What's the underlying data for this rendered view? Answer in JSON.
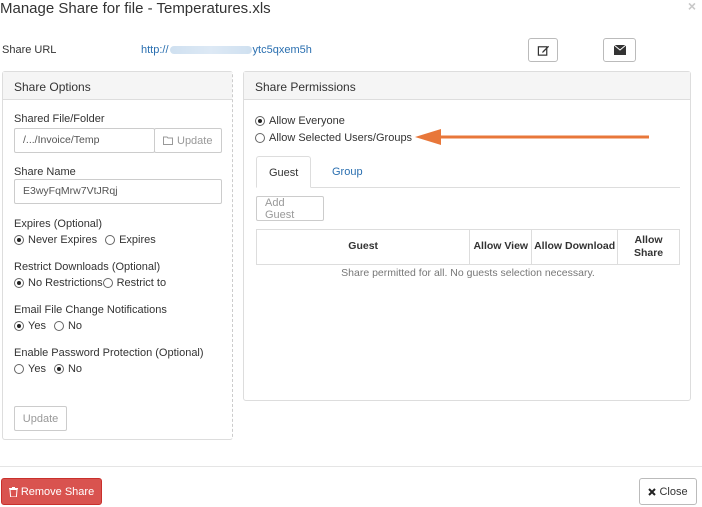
{
  "dialog": {
    "title": "Manage Share for file - Temperatures.xls",
    "close_glyph": "×"
  },
  "share_url": {
    "label": "Share URL",
    "link_start": "http://",
    "link_end": "ytc5qxem5h"
  },
  "share_options": {
    "heading": "Share Options",
    "file_label": "Shared File/Folder",
    "file_value": "/.../Invoice/Temp",
    "update_path_label": "Update",
    "name_label": "Share Name",
    "name_value": "E3wyFqMrw7VtJRqj",
    "expires_label": "Expires (Optional)",
    "expires_options": [
      "Never Expires",
      "Expires"
    ],
    "restrict_label": "Restrict Downloads (Optional)",
    "restrict_options": [
      "No Restrictions",
      "Restrict to"
    ],
    "email_label": "Email File Change Notifications",
    "email_options": [
      "Yes",
      "No"
    ],
    "password_label": "Enable Password Protection (Optional)",
    "password_options": [
      "Yes",
      "No"
    ],
    "update_button": "Update"
  },
  "share_permissions": {
    "heading": "Share Permissions",
    "allow_everyone": "Allow Everyone",
    "allow_selected": "Allow Selected Users/Groups",
    "tabs": [
      "Guest",
      "Group"
    ],
    "add_guest": "Add Guest",
    "columns": [
      "Guest",
      "Allow View",
      "Allow Download",
      "Allow Share"
    ],
    "empty_message": "Share permitted for all. No guests selection necessary."
  },
  "footer": {
    "remove_share": "Remove Share",
    "close": "Close"
  },
  "colors": {
    "accent_link": "#2a6fb0",
    "danger": "#d9534f",
    "annotation_arrow": "#e8773a"
  }
}
